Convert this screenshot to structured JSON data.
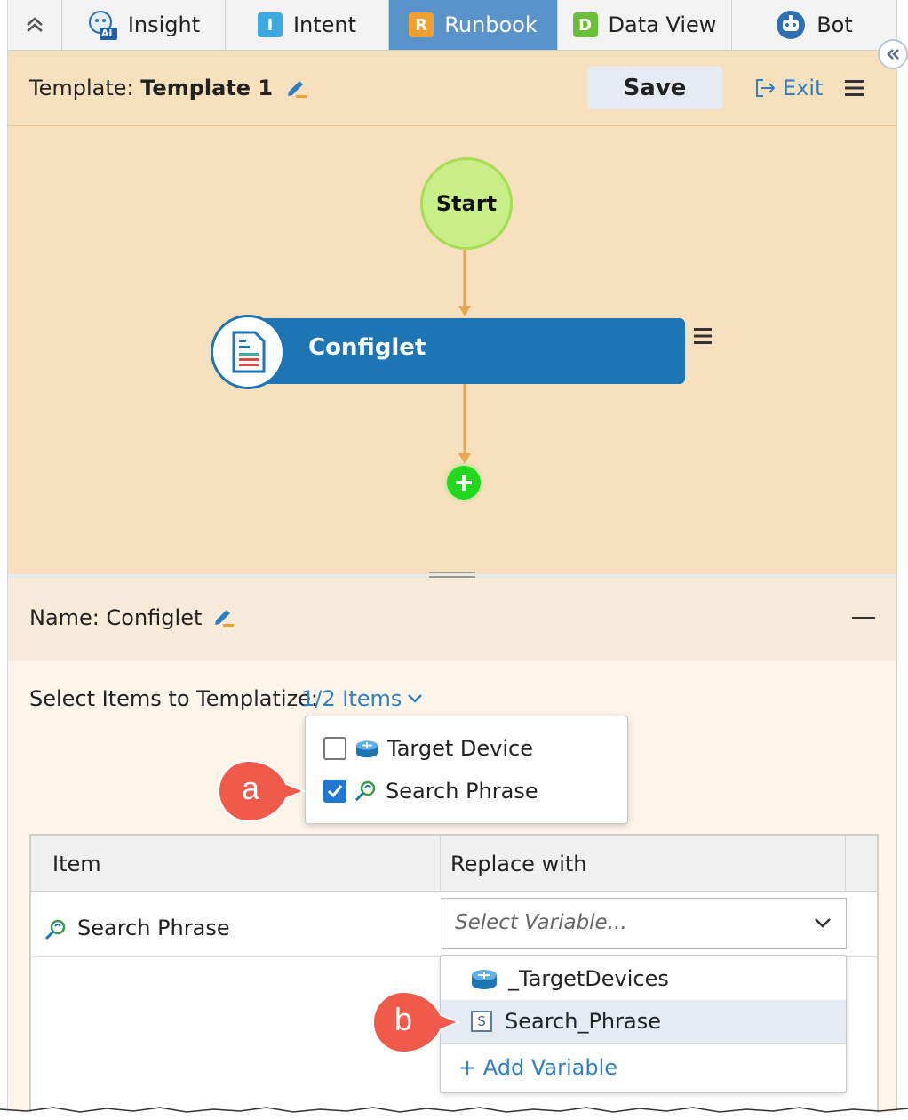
{
  "tabs": [
    {
      "label": "Insight",
      "icon": "insight-ai-icon",
      "active": false
    },
    {
      "label": "Intent",
      "icon": "intent-icon",
      "letter": "I",
      "active": false
    },
    {
      "label": "Runbook",
      "icon": "runbook-icon",
      "letter": "R",
      "active": true
    },
    {
      "label": "Data View",
      "icon": "data-view-icon",
      "letter": "D",
      "active": false
    },
    {
      "label": "Bot",
      "icon": "bot-icon",
      "active": false
    }
  ],
  "insight_badge": "AI",
  "header": {
    "template_prefix": "Template:",
    "template_name": "Template 1",
    "save_label": "Save",
    "exit_label": "Exit"
  },
  "flow": {
    "start_label": "Start",
    "node_label": "Configlet"
  },
  "node_panel": {
    "name_prefix": "Name:",
    "name_value": "Configlet"
  },
  "templatize": {
    "label": "Select Items to Templatize:",
    "count": "1/2 Items",
    "items": [
      {
        "label": "Target Device",
        "checked": false,
        "icon": "device-router-icon"
      },
      {
        "label": "Search Phrase",
        "checked": true,
        "icon": "search-phrase-icon"
      }
    ]
  },
  "table": {
    "col_item": "Item",
    "col_replace": "Replace with",
    "rows": [
      {
        "item": "Search Phrase",
        "placeholder": "Select Variable..."
      }
    ]
  },
  "variable_dropdown": {
    "options": [
      {
        "label": "_TargetDevices",
        "icon": "device-router-icon",
        "highlighted": false
      },
      {
        "label": "Search_Phrase",
        "icon": "string-variable-icon",
        "type_letter": "S",
        "highlighted": true
      }
    ],
    "add_label": "+ Add Variable"
  },
  "callouts": {
    "a": "a",
    "b": "b"
  },
  "colors": {
    "accent_blue": "#2f7fc1",
    "node_blue": "#1e75b3",
    "canvas_bg": "#f7e0bd",
    "callout_red": "#ef5a4a",
    "start_green": "#c8ee88",
    "connector": "#e6a84f"
  }
}
